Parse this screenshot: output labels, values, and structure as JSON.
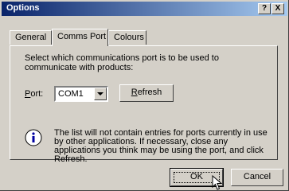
{
  "window": {
    "title": "Options",
    "help_button": "?",
    "close_button": "X"
  },
  "tabs": [
    {
      "label": "General",
      "active": false
    },
    {
      "label": "Comms Port",
      "active": true
    },
    {
      "label": "Colours",
      "active": false
    }
  ],
  "panel": {
    "description": "Select which communications port is to be used to communicate with products:",
    "port_label_accel": "P",
    "port_label_rest": "ort:",
    "port_value": "COM1",
    "refresh_accel": "R",
    "refresh_rest": "efresh",
    "info_text": "The list will not contain entries for ports currently in use by other applications. If necessary, close any applications you think may be using the port, and click Refresh."
  },
  "buttons": {
    "ok": "OK",
    "cancel": "Cancel"
  },
  "icons": {
    "info": "info-icon",
    "dropdown": "chevron-down-icon",
    "cursor": "mouse-pointer-icon"
  },
  "colors": {
    "titlebar_start": "#0a246a",
    "titlebar_end": "#a6caf0",
    "face": "#d4d0c8"
  }
}
